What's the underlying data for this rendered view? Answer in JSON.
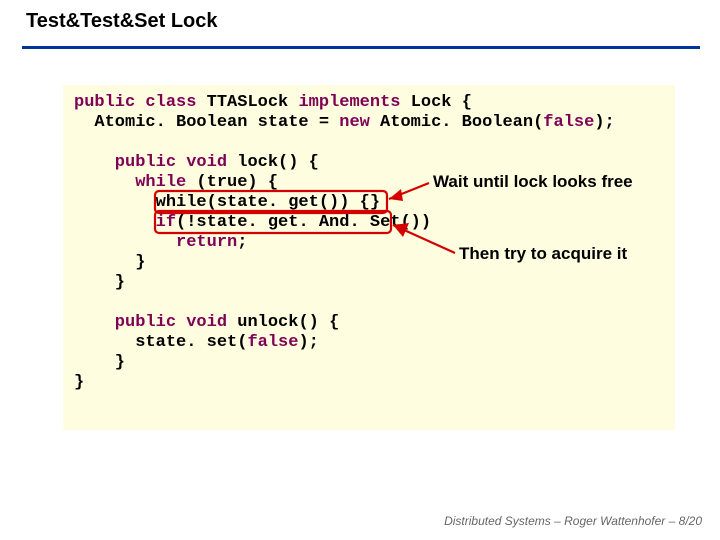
{
  "title": "Test&Test&Set Lock",
  "code": {
    "l1a": "public",
    "l1b": " class",
    "l1c": " TTASLock ",
    "l1d": "implements",
    "l1e": " Lock {",
    "l2a": "  Atomic. Boolean state = ",
    "l2b": "new",
    "l2c": " Atomic. Boolean(",
    "l2d": "false",
    "l2e": ");",
    "blank1": " ",
    "l3a": "    public",
    "l3b": " void",
    "l3c": " lock() {",
    "l4a": "      while",
    "l4b": " (true) {",
    "l5": "        while(state. get()) {}",
    "l6a": "        if",
    "l6b": "(!state. get. And. Set())",
    "l7a": "          return",
    "l7b": ";",
    "l8": "      }",
    "l9": "    }",
    "blank2": " ",
    "l10a": "    public",
    "l10b": " void",
    "l10c": " unlock() {",
    "l11a": "      state. set(",
    "l11b": "false",
    "l11c": ");",
    "l12": "    }",
    "l13": "}"
  },
  "notes": {
    "free": "Wait until lock looks free",
    "acquire": "Then try to acquire it"
  },
  "footer": {
    "course": "Distributed Systems",
    "sep1": "  –  ",
    "author": "Roger Wattenhofer",
    "sep2": "   – ",
    "page": "8/20"
  }
}
